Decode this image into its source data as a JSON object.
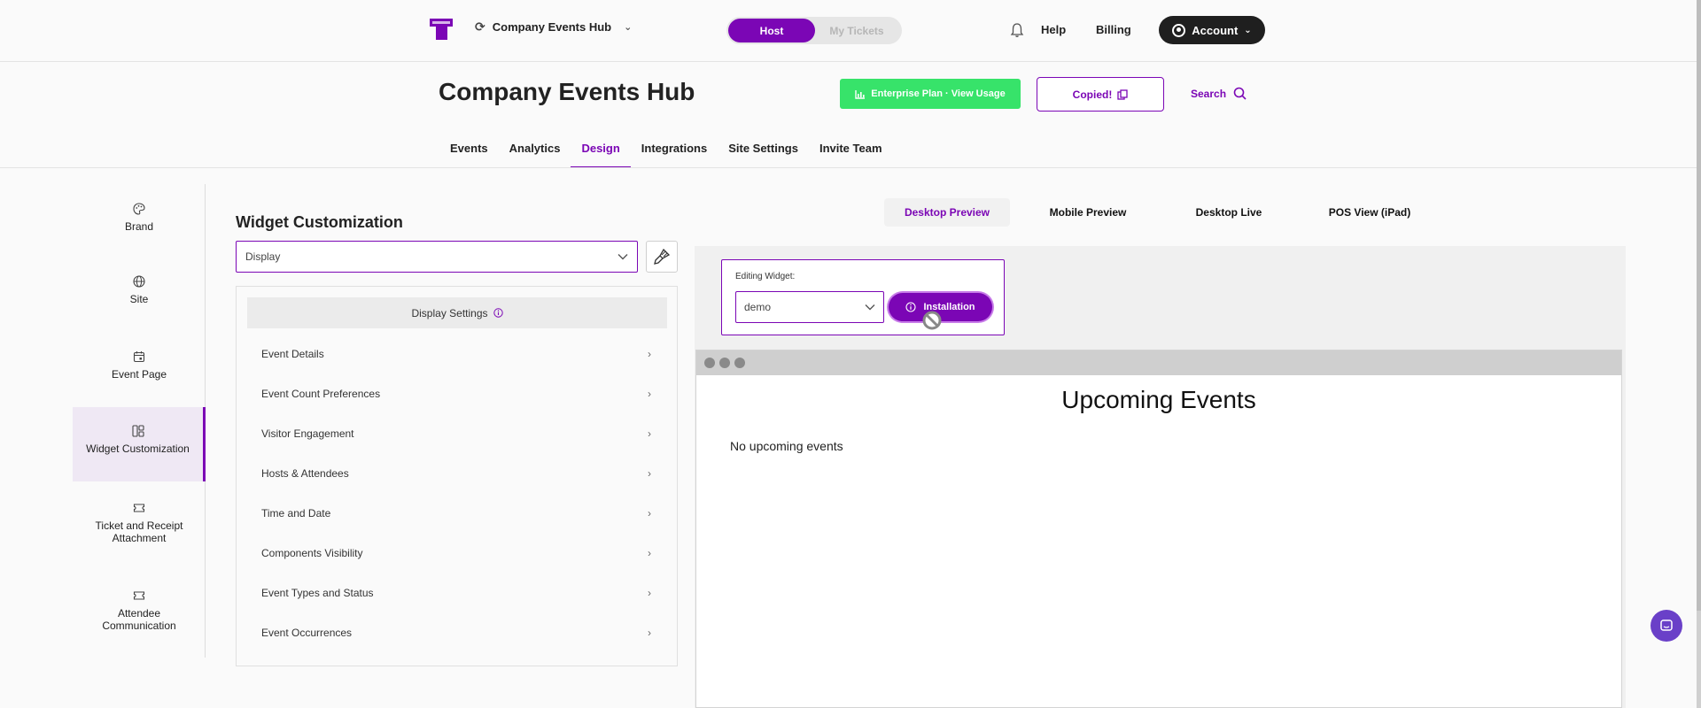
{
  "topbar": {
    "workspace_name": "Company Events Hub",
    "toggle_host": "Host",
    "toggle_tickets": "My Tickets",
    "help": "Help",
    "billing": "Billing",
    "account": "Account"
  },
  "header": {
    "title": "Company Events Hub",
    "plan_button": "Enterprise Plan · View Usage",
    "copied_button": "Copied!",
    "search": "Search"
  },
  "tabs": [
    "Events",
    "Analytics",
    "Design",
    "Integrations",
    "Site Settings",
    "Invite Team"
  ],
  "active_tab": "Design",
  "sidebar": {
    "items": [
      {
        "label": "Brand",
        "icon": "palette-icon"
      },
      {
        "label": "Site",
        "icon": "globe-icon"
      },
      {
        "label": "Event Page",
        "icon": "calendar-icon"
      },
      {
        "label": "Widget Customization",
        "icon": "layout-icon"
      },
      {
        "label": "Ticket and Receipt Attachment",
        "icon": "ticket-icon"
      },
      {
        "label": "Attendee Communication",
        "icon": "ticket-icon"
      }
    ],
    "active": "Widget Customization"
  },
  "panel": {
    "title": "Widget Customization",
    "select_value": "Display",
    "settings_header": "Display Settings",
    "settings_items": [
      "Event Details",
      "Event Count Preferences",
      "Visitor Engagement",
      "Hosts & Attendees",
      "Time and Date",
      "Components Visibility",
      "Event Types and Status",
      "Event Occurrences"
    ]
  },
  "preview": {
    "tabs": [
      "Desktop Preview",
      "Mobile Preview",
      "Desktop Live",
      "POS View (iPad)"
    ],
    "active_tab": "Desktop Preview",
    "editing_label": "Editing Widget:",
    "widget_value": "demo",
    "installation_button": "Installation",
    "widget_title": "Upcoming Events",
    "empty_message": "No upcoming events"
  },
  "colors": {
    "accent": "#7b06b5",
    "plan_green": "#37e36a",
    "account_bg": "#1f1f1f"
  }
}
